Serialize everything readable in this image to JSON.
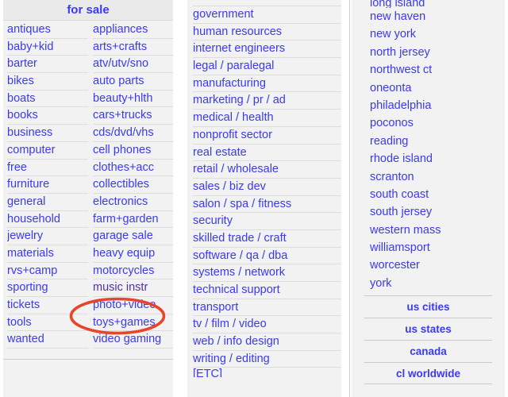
{
  "page": {
    "link_color": "#3a3aee",
    "visited_link_color": "#55309c",
    "annotation_color": "#e8452a",
    "background": "#f2f2f2"
  },
  "for_sale": {
    "banner": "for sale",
    "left_items": [
      "antiques",
      "baby+kid",
      "barter",
      "bikes",
      "boats",
      "books",
      "business",
      "computer",
      "free",
      "furniture",
      "general",
      "household",
      "jewelry",
      "materials",
      "rvs+camp",
      "sporting",
      "tickets",
      "tools",
      "wanted"
    ],
    "right_items": [
      "appliances",
      "arts+crafts",
      "atv/utv/sno",
      "auto parts",
      "beauty+hlth",
      "cars+trucks",
      "cds/dvd/vhs",
      "cell phones",
      "clothes+acc",
      "collectibles",
      "electronics",
      "farm+garden",
      "garage sale",
      "heavy equip",
      "motorcycles",
      "music instr",
      "photo+video",
      "toys+games",
      "video gaming"
    ],
    "visited_item": "music instr",
    "annotated_item": "music instr"
  },
  "jobs": {
    "clipped_top_item": "",
    "items": [
      "government",
      "human resources",
      "internet engineers",
      "legal / paralegal",
      "manufacturing",
      "marketing / pr / ad",
      "medical / health",
      "nonprofit sector",
      "real estate",
      "retail / wholesale",
      "sales / biz dev",
      "salon / spa / fitness",
      "security",
      "skilled trade / craft",
      "software / qa / dba",
      "systems / network",
      "technical support",
      "transport",
      "tv / film / video",
      "web / info design",
      "writing / editing"
    ],
    "clipped_bottom_item": "[ETC]"
  },
  "nearby": {
    "clipped_top_item": "long island",
    "items": [
      "new haven",
      "new york",
      "north jersey",
      "northwest ct",
      "oneonta",
      "philadelphia",
      "poconos",
      "reading",
      "rhode island",
      "scranton",
      "south coast",
      "south jersey",
      "western mass",
      "williamsport",
      "worcester",
      "york"
    ],
    "footer_links": [
      "us cities",
      "us states",
      "canada",
      "cl worldwide"
    ]
  }
}
